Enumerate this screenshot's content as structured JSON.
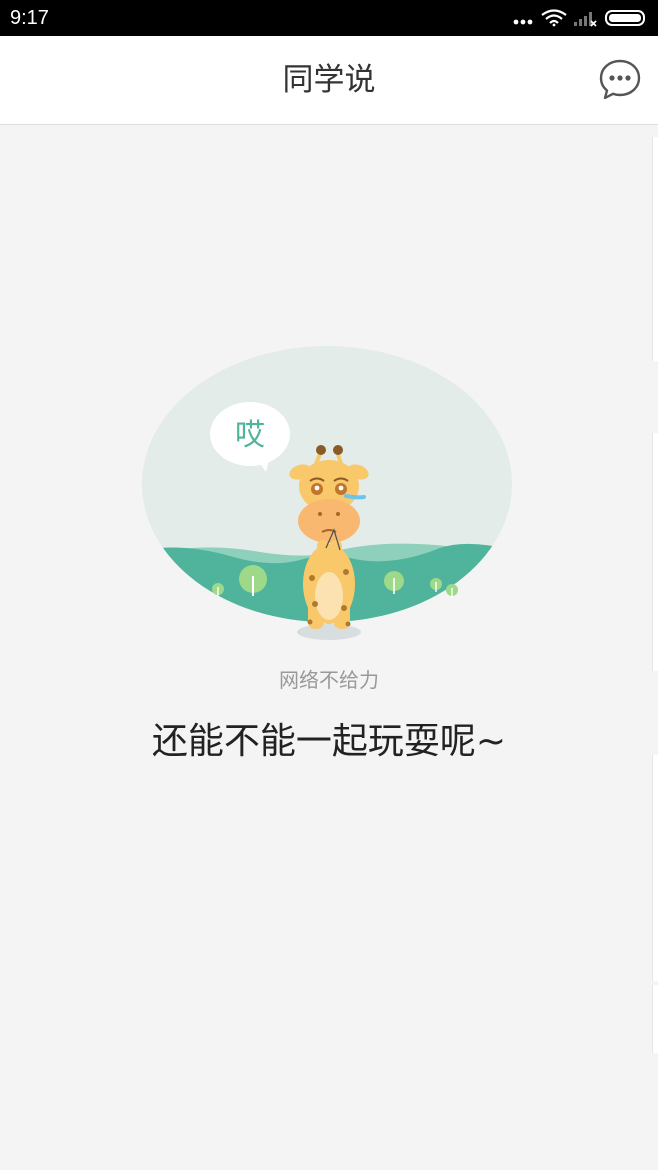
{
  "status_bar": {
    "time": "9:17"
  },
  "header": {
    "title": "同学说"
  },
  "illustration": {
    "bubble_text": "哎"
  },
  "empty_state": {
    "subtitle": "网络不给力",
    "message": "还能不能一起玩耍呢~"
  },
  "colors": {
    "hill_dark": "#4fb49b",
    "hill_light": "#8fd0bd",
    "oval_bg": "#e3ece8",
    "giraffe": "#f8c86a",
    "giraffe_face": "#f8b870"
  },
  "icons": {
    "chat": "chat-bubble-icon",
    "wifi": "wifi-icon",
    "signal": "signal-icon",
    "battery": "battery-icon",
    "more": "more-dots-icon"
  }
}
